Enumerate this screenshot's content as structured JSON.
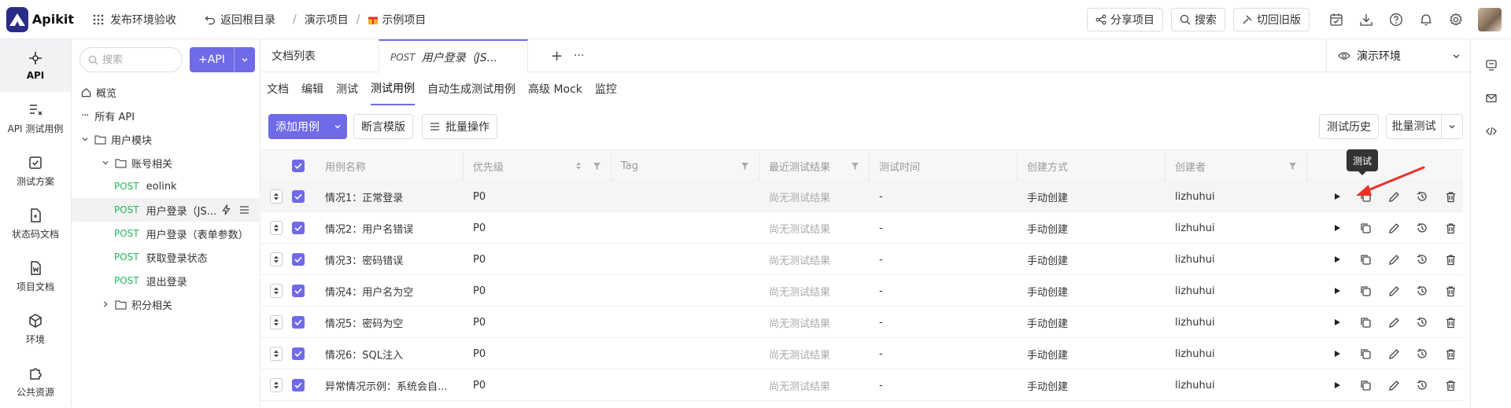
{
  "topbar": {
    "app_name": "Apikit",
    "workspace": "发布环境验收",
    "back_root": "返回根目录",
    "crumb_1": "演示项目",
    "crumb_sep": "/",
    "crumb_2": "示例项目",
    "share": "分享项目",
    "search": "搜索",
    "switch_old": "切回旧版"
  },
  "leftnav": [
    {
      "label": "API"
    },
    {
      "label": "API 测试用例"
    },
    {
      "label": "测试方案"
    },
    {
      "label": "状态码文档"
    },
    {
      "label": "项目文档"
    },
    {
      "label": "环境"
    },
    {
      "label": "公共资源"
    }
  ],
  "tree": {
    "search_placeholder": "搜索",
    "add_api": "+API",
    "overview": "概览",
    "all_api": "所有 API",
    "group_user": "用户模块",
    "group_account": "账号相关",
    "group_points": "积分相关",
    "apis": [
      {
        "method": "POST",
        "name": "eolink"
      },
      {
        "method": "POST",
        "name": "用户登录（JS..."
      },
      {
        "method": "POST",
        "name": "用户登录（表单参数）"
      },
      {
        "method": "POST",
        "name": "获取登录状态"
      },
      {
        "method": "POST",
        "name": "退出登录"
      }
    ]
  },
  "tabs": {
    "doc_list": "文档列表",
    "active_method": "POST",
    "active_name": "用户登录（JS...",
    "add": "+",
    "more": "···",
    "env": "演示环境"
  },
  "subtabs": [
    "文档",
    "编辑",
    "测试",
    "测试用例",
    "自动生成测试用例",
    "高级 Mock",
    "监控"
  ],
  "toolbar": {
    "add_case": "添加用例",
    "assert_tpl": "断言模版",
    "batch_ops": "批量操作",
    "history": "测试历史",
    "batch_test": "批量测试"
  },
  "table": {
    "headers": [
      "用例名称",
      "优先级",
      "Tag",
      "最近测试结果",
      "测试时间",
      "创建方式",
      "创建者"
    ],
    "rows": [
      {
        "name": "情况1：正常登录",
        "priority": "P0",
        "tag": "",
        "result": "尚无测试结果",
        "time": "-",
        "method": "手动创建",
        "creator": "lizhuhui"
      },
      {
        "name": "情况2：用户名错误",
        "priority": "P0",
        "tag": "",
        "result": "尚无测试结果",
        "time": "-",
        "method": "手动创建",
        "creator": "lizhuhui"
      },
      {
        "name": "情况3：密码错误",
        "priority": "P0",
        "tag": "",
        "result": "尚无测试结果",
        "time": "-",
        "method": "手动创建",
        "creator": "lizhuhui"
      },
      {
        "name": "情况4：用户名为空",
        "priority": "P0",
        "tag": "",
        "result": "尚无测试结果",
        "time": "-",
        "method": "手动创建",
        "creator": "lizhuhui"
      },
      {
        "name": "情况5：密码为空",
        "priority": "P0",
        "tag": "",
        "result": "尚无测试结果",
        "time": "-",
        "method": "手动创建",
        "creator": "lizhuhui"
      },
      {
        "name": "情况6：SQL注入",
        "priority": "P0",
        "tag": "",
        "result": "尚无测试结果",
        "time": "-",
        "method": "手动创建",
        "creator": "lizhuhui"
      },
      {
        "name": "异常情况示例：系统会自...",
        "priority": "P0",
        "tag": "",
        "result": "尚无测试结果",
        "time": "-",
        "method": "手动创建",
        "creator": "lizhuhui"
      }
    ]
  },
  "tooltip": "测试",
  "colors": {
    "accent": "#6f6ae8",
    "post": "#27b35a",
    "arrow": "#e8322b"
  }
}
